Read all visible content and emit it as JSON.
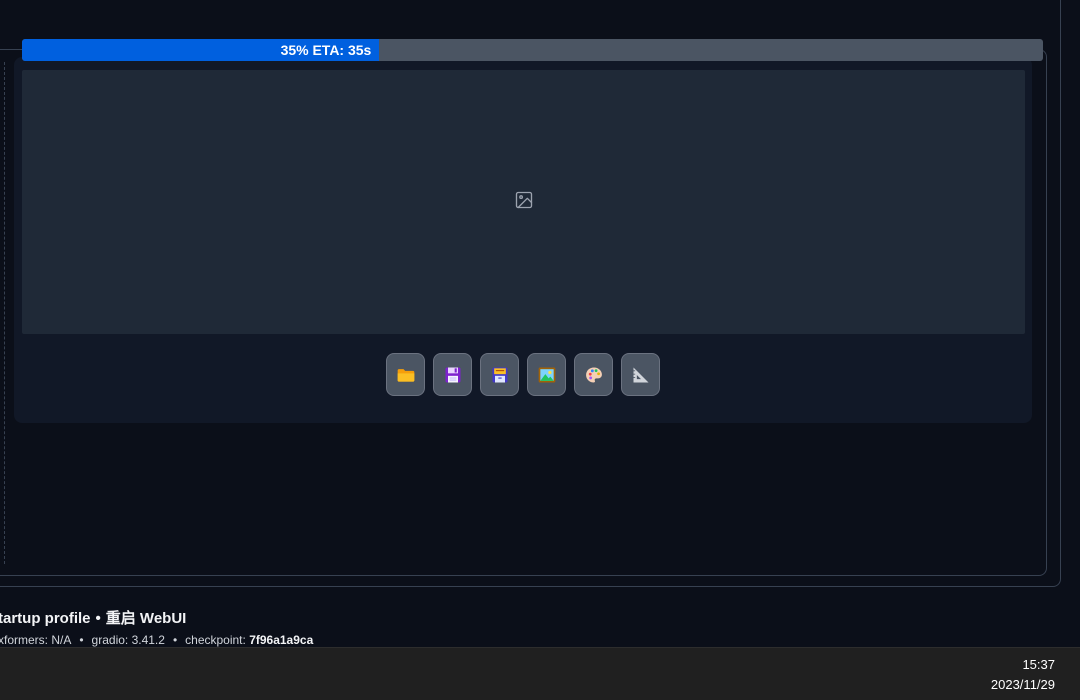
{
  "progress": {
    "percent": 35,
    "label": "35% ETA: 35s"
  },
  "gallery": {
    "placeholder_icon": "image-icon"
  },
  "toolbar": {
    "buttons": [
      {
        "name": "open-folder-button",
        "icon": "folder-icon",
        "color": "#fbbf24"
      },
      {
        "name": "save-button",
        "icon": "floppy-disk-icon",
        "color": "#a855f7"
      },
      {
        "name": "zip-button",
        "icon": "archive-icon",
        "color": "#6366f1"
      },
      {
        "name": "send-to-img2img-button",
        "icon": "picture-icon",
        "color": "#22c55e"
      },
      {
        "name": "send-to-inpaint-button",
        "icon": "palette-icon",
        "color": "#f0abfc"
      },
      {
        "name": "send-to-extras-button",
        "icon": "triangle-ruler-icon",
        "color": "#9ca3af"
      }
    ]
  },
  "footer": {
    "startup_profile": "tartup profile",
    "separator": "•",
    "restart_webui": "重启 WebUI",
    "xformers": "xformers: N/A",
    "gradio": "gradio: 3.41.2",
    "checkpoint_label": "checkpoint:",
    "checkpoint_hash": "7f96a1a9ca"
  },
  "taskbar": {
    "time": "15:37",
    "date": "2023/11/29"
  },
  "colors": {
    "background": "#0b0f19",
    "progress_fill": "#0060df",
    "progress_track": "#4b5563",
    "image_area": "#1f2937"
  }
}
